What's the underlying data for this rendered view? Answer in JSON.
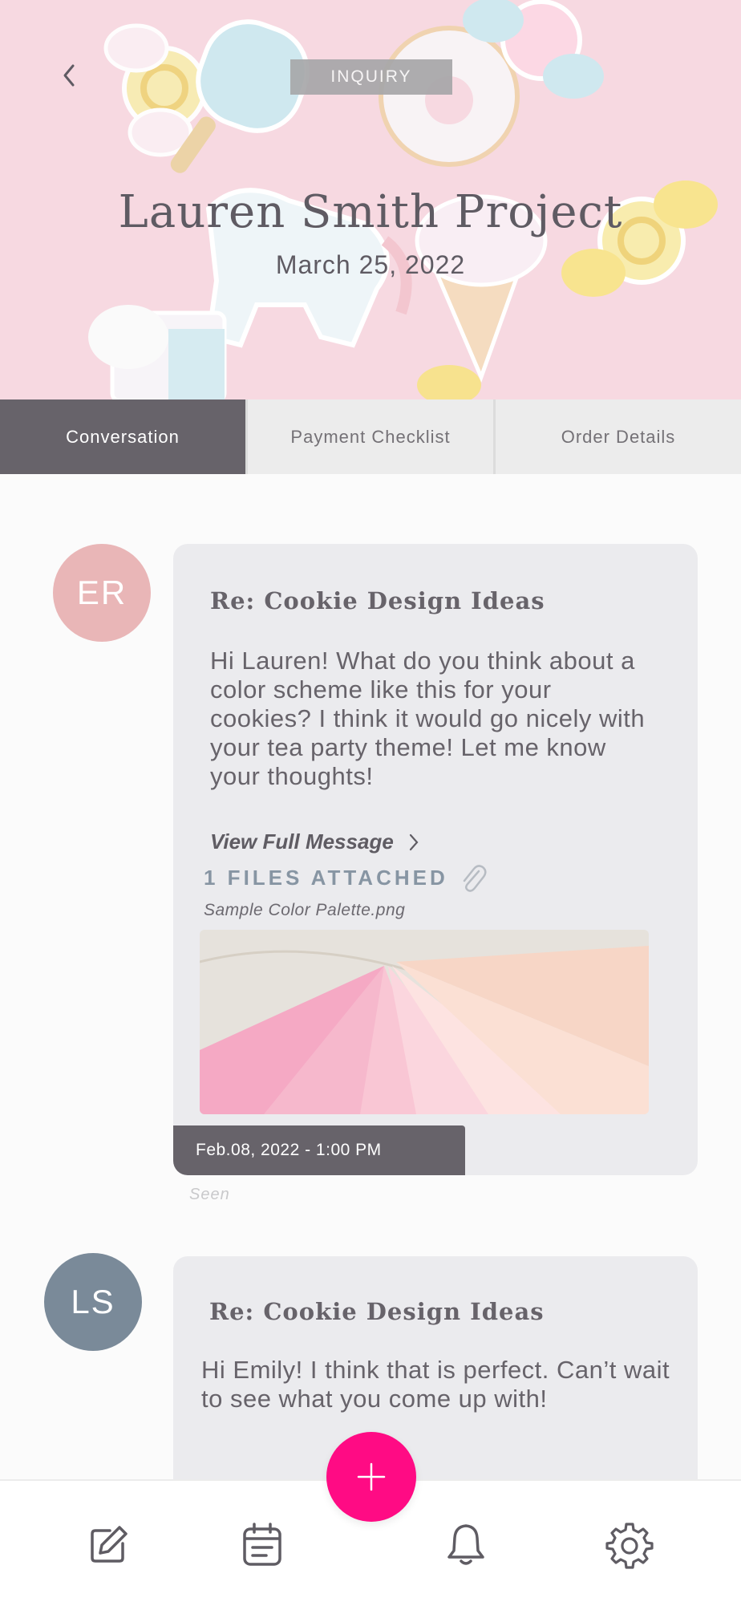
{
  "header": {
    "badge": "INQUIRY",
    "title": "Lauren Smith Project",
    "date": "March 25, 2022"
  },
  "tabs": [
    {
      "label": "Conversation",
      "active": true
    },
    {
      "label": "Payment Checklist",
      "active": false
    },
    {
      "label": "Order Details",
      "active": false
    }
  ],
  "messages": [
    {
      "initials": "ER",
      "avatar_color": "#e9b6b7",
      "subject": "Re: Cookie Design Ideas",
      "body": "Hi Lauren! What do you think about a color scheme like this for your cookies? I think it would go nicely with your tea party theme! Let me know your thoughts!",
      "view_full": "View Full Message",
      "files_attached": "1 FILES ATTACHED",
      "file_name": "Sample Color Palette.png",
      "timestamp": "Feb.08, 2022 - 1:00 PM",
      "status": "Seen"
    },
    {
      "initials": "LS",
      "avatar_color": "#7a8a99",
      "subject": "Re: Cookie Design Ideas",
      "body": "Hi Emily! I think that is perfect. Can’t wait to see what you come up with!"
    }
  ],
  "colors": {
    "accent": "#ff0b84",
    "tab_active": "#67636a",
    "card_bg": "#ebebee"
  },
  "bottom_nav": {
    "icons": [
      "edit-icon",
      "calendar-icon",
      "bell-icon",
      "gear-icon"
    ],
    "fab_icon": "plus-icon"
  }
}
